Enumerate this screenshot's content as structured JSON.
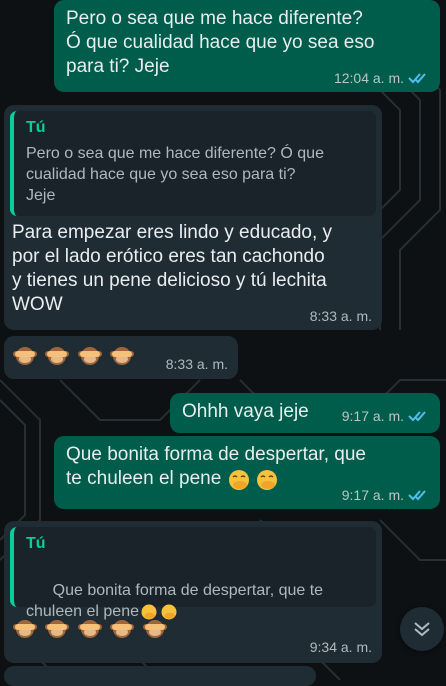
{
  "messages": [
    {
      "type": "outgoing",
      "text": "Pero o sea que me hace diferente?\nÓ que cualidad hace que yo sea eso\npara ti? Jeje",
      "time": "12:04 a. m.",
      "status": "read"
    },
    {
      "type": "incoming",
      "quote": {
        "author": "Tú",
        "text": "Pero o sea que me hace diferente? Ó que\ncualidad hace que yo sea eso para ti?\nJeje"
      },
      "text": "Para empezar eres lindo y educado, y\npor el lado erótico eres tan cachondo\ny tienes un pene delicioso y tú lechita\nWOW",
      "time": "8:33 a. m."
    },
    {
      "type": "incoming",
      "emoji": "see-no-evil-monkey",
      "emoji_count": 4,
      "time": "8:33 a. m."
    },
    {
      "type": "outgoing",
      "text": "Ohhh vaya jeje",
      "time": "9:17 a. m.",
      "status": "read"
    },
    {
      "type": "outgoing",
      "text": "Que bonita forma de despertar, que\nte chuleen el pene",
      "emoji": "face-with-hand-over-mouth",
      "emoji_count": 2,
      "time": "9:17 a. m.",
      "status": "read"
    },
    {
      "type": "incoming",
      "quote": {
        "author": "Tú",
        "text": "Que bonita forma de despertar, que te\nchuleen el pene",
        "emoji": "face-with-hand-over-mouth",
        "emoji_count": 2
      },
      "emoji": "see-no-evil-monkey",
      "emoji_count": 5,
      "time": "9:34 a. m."
    }
  ],
  "scroll_button_icon": "double-chevron-down-icon",
  "colors": {
    "outgoing_bubble": "#005c4b",
    "incoming_bubble": "#202c33",
    "quote_accent": "#06cf9c",
    "read_ticks": "#53bdeb"
  }
}
